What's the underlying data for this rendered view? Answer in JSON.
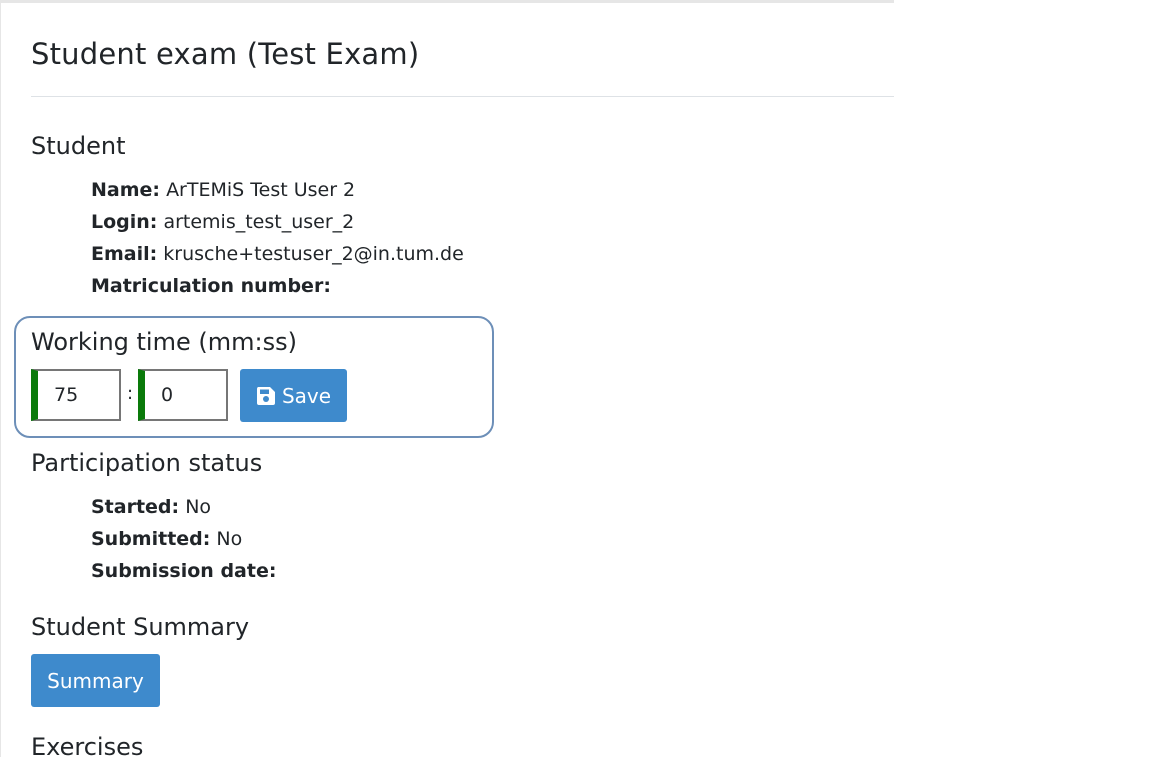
{
  "page": {
    "title": "Student exam (Test Exam)"
  },
  "student": {
    "heading": "Student",
    "fields": [
      {
        "label": "Name:",
        "value": "ArTEMiS Test User 2"
      },
      {
        "label": "Login:",
        "value": "artemis_test_user_2"
      },
      {
        "label": "Email:",
        "value": "krusche+testuser_2@in.tum.de"
      },
      {
        "label": "Matriculation number:",
        "value": ""
      }
    ]
  },
  "working_time": {
    "heading": "Working time (mm:ss)",
    "minutes": "75",
    "seconds": "0",
    "separator": ":",
    "save_label": "Save",
    "save_icon": "floppy-disk-icon"
  },
  "participation": {
    "heading": "Participation status",
    "fields": [
      {
        "label": "Started:",
        "value": "No"
      },
      {
        "label": "Submitted:",
        "value": "No"
      },
      {
        "label": "Submission date:",
        "value": ""
      }
    ]
  },
  "summary": {
    "heading": "Student Summary",
    "button_label": "Summary"
  },
  "exercises": {
    "heading": "Exercises"
  },
  "colors": {
    "primary_button": "#3e8acc",
    "valid_input_border": "#0a7a0a",
    "highlight_box": "#6d8fb8"
  }
}
